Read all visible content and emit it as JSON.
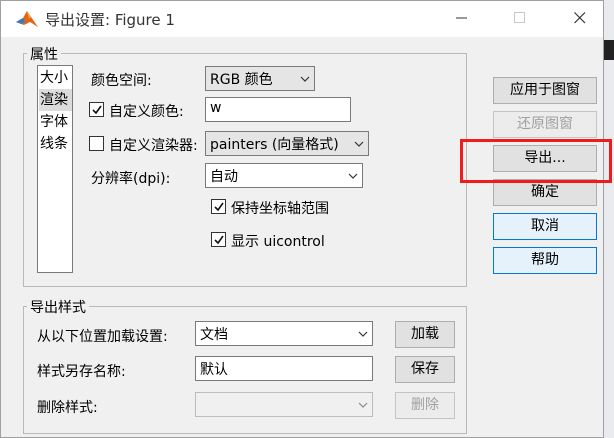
{
  "window": {
    "title": "导出设置: Figure 1"
  },
  "properties": {
    "group_label": "属性",
    "list_items": [
      {
        "label": "大小",
        "selected": false
      },
      {
        "label": "渲染",
        "selected": true
      },
      {
        "label": "字体",
        "selected": false
      },
      {
        "label": "线条",
        "selected": false
      }
    ],
    "colorspace": {
      "label": "颜色空间:",
      "value": "RGB 颜色"
    },
    "custom_color": {
      "label": "自定义颜色:",
      "checked": true,
      "value": "w"
    },
    "custom_renderer": {
      "label": "自定义渲染器:",
      "checked": false,
      "value": "painters (向量格式)"
    },
    "resolution": {
      "label": "分辨率(dpi):",
      "value": "自动"
    },
    "keep_axes": {
      "label": "保持坐标轴范围",
      "checked": true
    },
    "show_uicontrol": {
      "label": "显示 uicontrol",
      "checked": true
    }
  },
  "buttons": {
    "apply": "应用于图窗",
    "restore": "还原图窗",
    "export": "导出...",
    "ok": "确定",
    "cancel": "取消",
    "help": "帮助"
  },
  "export_styles": {
    "group_label": "导出样式",
    "load_label": "从以下位置加载设置:",
    "load_value": "文档",
    "load_button": "加载",
    "save_label": "样式另存名称:",
    "save_value": "默认",
    "save_button": "保存",
    "delete_label": "删除样式:",
    "delete_value": "",
    "delete_button": "删除"
  },
  "colors": {
    "highlight": "#ee1c1c",
    "primary_border": "#0078d7"
  }
}
